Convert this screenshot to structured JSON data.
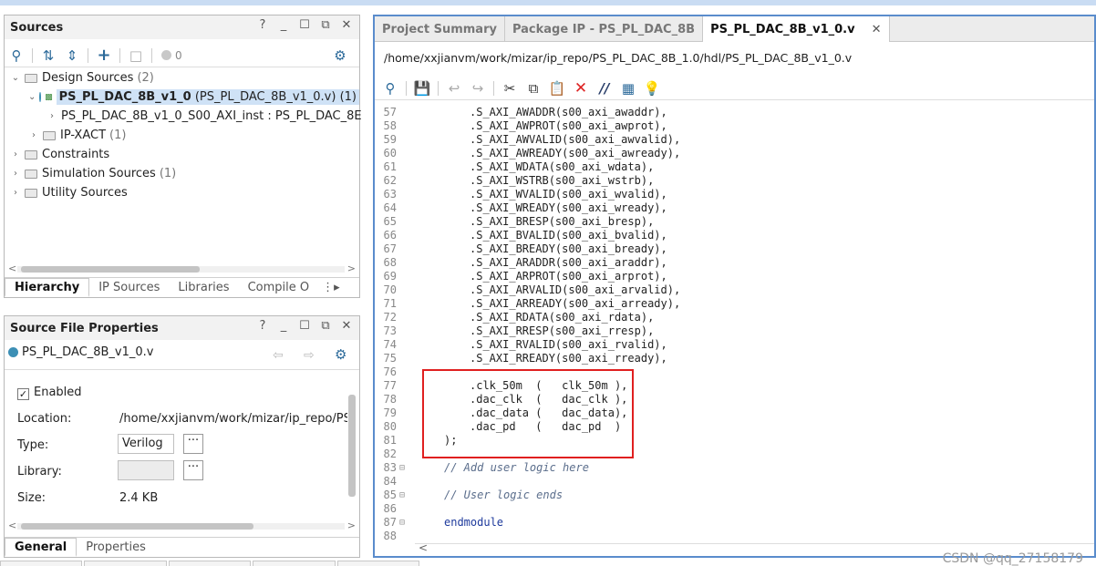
{
  "sources": {
    "title": "Sources",
    "header_icons": [
      "?",
      "_",
      "☐",
      "⧉",
      "✕"
    ],
    "toolbar_count": "0",
    "tree": [
      {
        "label": "Design Sources",
        "count": "(2)",
        "level": 0,
        "caret": "⌄",
        "kind": "folder"
      },
      {
        "label": "PS_PL_DAC_8B_v1_0",
        "suffix": "(PS_PL_DAC_8B_v1_0.v) (1)",
        "level": 1,
        "caret": "⌄",
        "kind": "top-module",
        "selected": true
      },
      {
        "label": "PS_PL_DAC_8B_v1_0_S00_AXI_inst : PS_PL_DAC_8E",
        "level": 2,
        "caret": "›",
        "kind": "module"
      },
      {
        "label": "IP-XACT",
        "count": "(1)",
        "level": 1,
        "caret": "›",
        "kind": "folder"
      },
      {
        "label": "Constraints",
        "level": 0,
        "caret": "›",
        "kind": "folder"
      },
      {
        "label": "Simulation Sources",
        "count": "(1)",
        "level": 0,
        "caret": "›",
        "kind": "folder"
      },
      {
        "label": "Utility Sources",
        "level": 0,
        "caret": "›",
        "kind": "folder"
      }
    ],
    "tabs": [
      "Hierarchy",
      "IP Sources",
      "Libraries",
      "Compile O"
    ]
  },
  "props": {
    "title": "Source File Properties",
    "header_icons": [
      "?",
      "_",
      "☐",
      "⧉",
      "✕"
    ],
    "file": "PS_PL_DAC_8B_v1_0.v",
    "enabled_label": "Enabled",
    "location_label": "Location:",
    "location_value": "/home/xxjianvm/work/mizar/ip_repo/PS_PL",
    "type_label": "Type:",
    "type_value": "Verilog",
    "library_label": "Library:",
    "size_label": "Size:",
    "size_value": "2.4 KB",
    "tabs": [
      "General",
      "Properties"
    ]
  },
  "editor": {
    "tabs": [
      "Project Summary",
      "Package IP - PS_PL_DAC_8B",
      "PS_PL_DAC_8B_v1_0.v"
    ],
    "close_glyph": "✕",
    "path": "/home/xxjianvm/work/mizar/ip_repo/PS_PL_DAC_8B_1.0/hdl/PS_PL_DAC_8B_v1_0.v",
    "lines": [
      {
        "n": "57",
        "text": ".S_AXI_AWADDR(s00_axi_awaddr),"
      },
      {
        "n": "58",
        "text": ".S_AXI_AWPROT(s00_axi_awprot),"
      },
      {
        "n": "59",
        "text": ".S_AXI_AWVALID(s00_axi_awvalid),"
      },
      {
        "n": "60",
        "text": ".S_AXI_AWREADY(s00_axi_awready),"
      },
      {
        "n": "61",
        "text": ".S_AXI_WDATA(s00_axi_wdata),"
      },
      {
        "n": "62",
        "text": ".S_AXI_WSTRB(s00_axi_wstrb),"
      },
      {
        "n": "63",
        "text": ".S_AXI_WVALID(s00_axi_wvalid),"
      },
      {
        "n": "64",
        "text": ".S_AXI_WREADY(s00_axi_wready),"
      },
      {
        "n": "65",
        "text": ".S_AXI_BRESP(s00_axi_bresp),"
      },
      {
        "n": "66",
        "text": ".S_AXI_BVALID(s00_axi_bvalid),"
      },
      {
        "n": "67",
        "text": ".S_AXI_BREADY(s00_axi_bready),"
      },
      {
        "n": "68",
        "text": ".S_AXI_ARADDR(s00_axi_araddr),"
      },
      {
        "n": "69",
        "text": ".S_AXI_ARPROT(s00_axi_arprot),"
      },
      {
        "n": "70",
        "text": ".S_AXI_ARVALID(s00_axi_arvalid),"
      },
      {
        "n": "71",
        "text": ".S_AXI_ARREADY(s00_axi_arready),"
      },
      {
        "n": "72",
        "text": ".S_AXI_RDATA(s00_axi_rdata),"
      },
      {
        "n": "73",
        "text": ".S_AXI_RRESP(s00_axi_rresp),"
      },
      {
        "n": "74",
        "text": ".S_AXI_RVALID(s00_axi_rvalid),"
      },
      {
        "n": "75",
        "text": ".S_AXI_RREADY(s00_axi_rready),"
      },
      {
        "n": "76",
        "text": ""
      },
      {
        "n": "77",
        "text": ".clk_50m  (   clk_50m ),"
      },
      {
        "n": "78",
        "text": ".dac_clk  (   dac_clk ),"
      },
      {
        "n": "79",
        "text": ".dac_data (   dac_data),"
      },
      {
        "n": "80",
        "text": ".dac_pd   (   dac_pd  )"
      },
      {
        "n": "81",
        "text": ");",
        "indent": "base"
      },
      {
        "n": "82",
        "text": ""
      },
      {
        "n": "83",
        "text": "// Add user logic here",
        "indent": "base",
        "style": "comment",
        "fold": true
      },
      {
        "n": "84",
        "text": ""
      },
      {
        "n": "85",
        "text": "// User logic ends",
        "indent": "base",
        "style": "comment",
        "fold": true
      },
      {
        "n": "86",
        "text": ""
      },
      {
        "n": "87",
        "text": "endmodule",
        "indent": "base",
        "style": "kw",
        "fold": true
      },
      {
        "n": "88",
        "text": ""
      }
    ]
  },
  "watermark": "CSDN @qq_27158179"
}
